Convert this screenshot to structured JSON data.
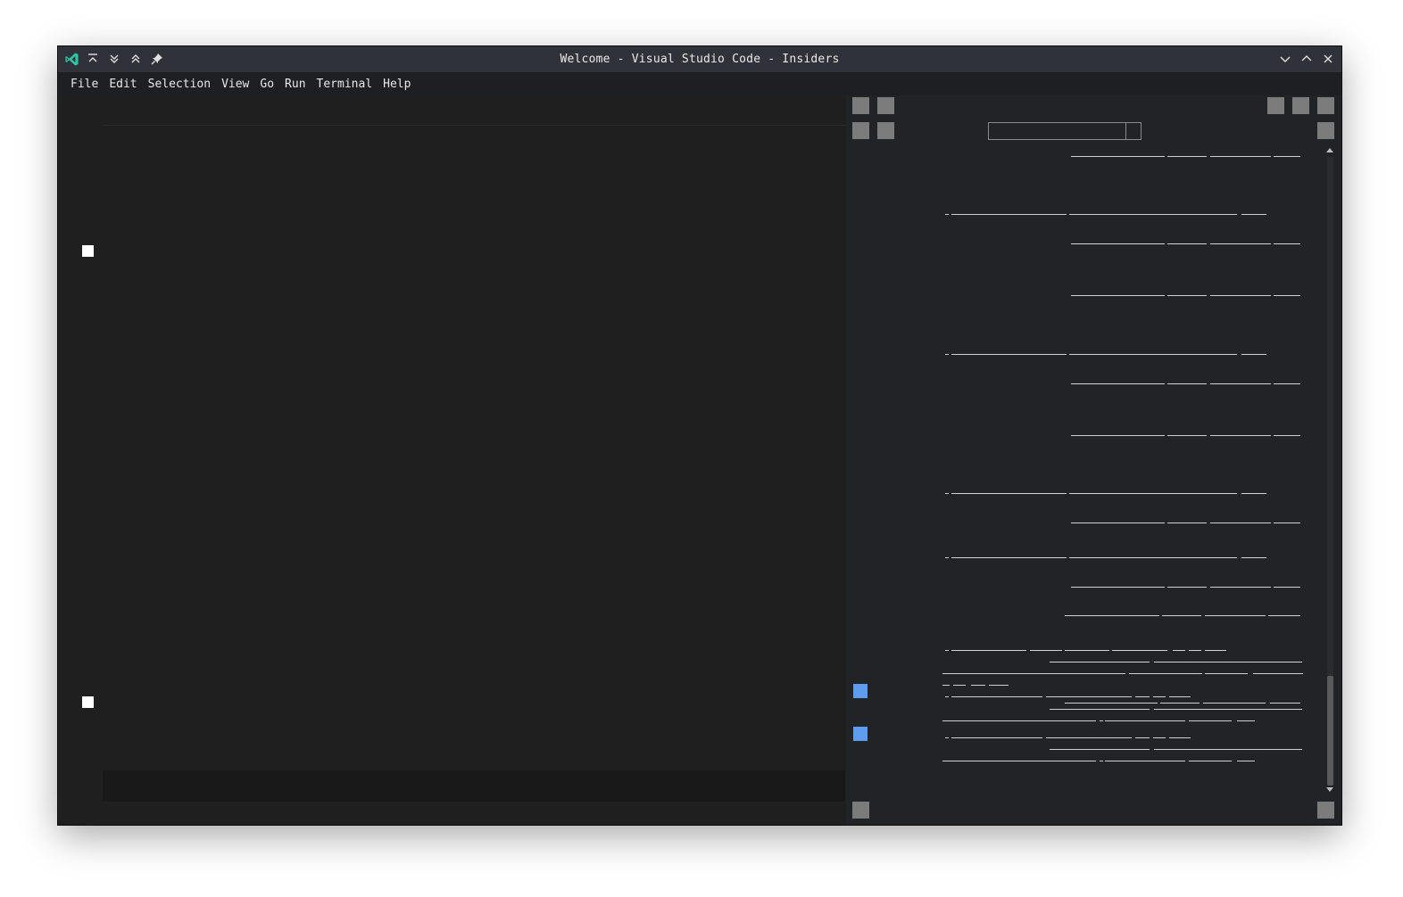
{
  "window": {
    "title": "Welcome - Visual Studio Code - Insiders",
    "titlebar_icons": [
      "vscode-insiders-logo-icon",
      "keep-above-icon",
      "keep-below-icon",
      "shade-icon",
      "pin-icon"
    ],
    "window_controls": [
      "minimize-icon",
      "maximize-icon",
      "close-icon"
    ]
  },
  "menubar": {
    "items": [
      "File",
      "Edit",
      "Selection",
      "View",
      "Go",
      "Run",
      "Terminal",
      "Help"
    ]
  },
  "colors": {
    "logo": "#2ec4a5",
    "editor_bg": "#1f1f1f",
    "panel_bg": "#222327",
    "accent_blue": "#5e9cf0",
    "placeholder_gray": "#7b7b7b"
  }
}
